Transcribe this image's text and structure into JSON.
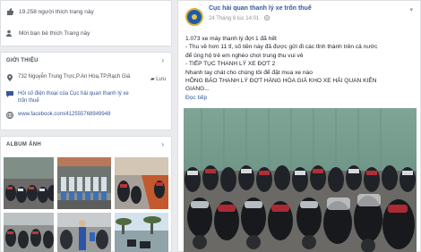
{
  "sidebar": {
    "stats": {
      "likes_text": "19.258 người thích trang này",
      "friends_text": "Mời bạn bè thích Trang này"
    },
    "intro": {
      "heading": "GIỚI THIỆU",
      "address": "732 Nguyễn Trung Trực,P.An Hòa,TP.Rạch Giá",
      "save_label": "Lưu",
      "phone_text_1": "Hỏi số điện thoại của Cục hải quan thanh lý xe",
      "phone_text_2": "trốn thuế",
      "website": "www.facebook.com/412555768949948"
    },
    "album": {
      "heading": "ALBUM ẢNH"
    }
  },
  "post": {
    "page_name": "Cục hải quan thanh lý xe trốn thuế",
    "time": "24 Tháng 8 lúc 14:01 · ",
    "lines": [
      "1.073 xe máy thanh lý đợt 1 đã hết",
      "- Thu về hơn 11 tỉ, số tiền này đã được gửi đi các tỉnh thành trên cả nước",
      "để ủng hộ trẻ em nghèo chơi trung thu vui vẻ",
      "- TIẾP TỤC THANH LÝ XE ĐỢT 2",
      "Nhanh tay chát cho chúng tôi để đặt mua xe nào",
      "HỒNG BÁO THANH LÝ ĐỢT HÀNG HÓA GIÁ KHO XE HẢI QUAN KIÊN",
      "GIANG..."
    ],
    "read_more": "Đọc tiếp"
  },
  "colors": {
    "link": "#365899",
    "page_bg": "#e9ebee",
    "card_bg": "#ffffff"
  },
  "icons": [
    "likes-icon",
    "friends-icon",
    "location-icon",
    "chat-icon",
    "globe-icon",
    "chevron-right-icon",
    "page-avatar-icon",
    "caret-down-icon"
  ]
}
